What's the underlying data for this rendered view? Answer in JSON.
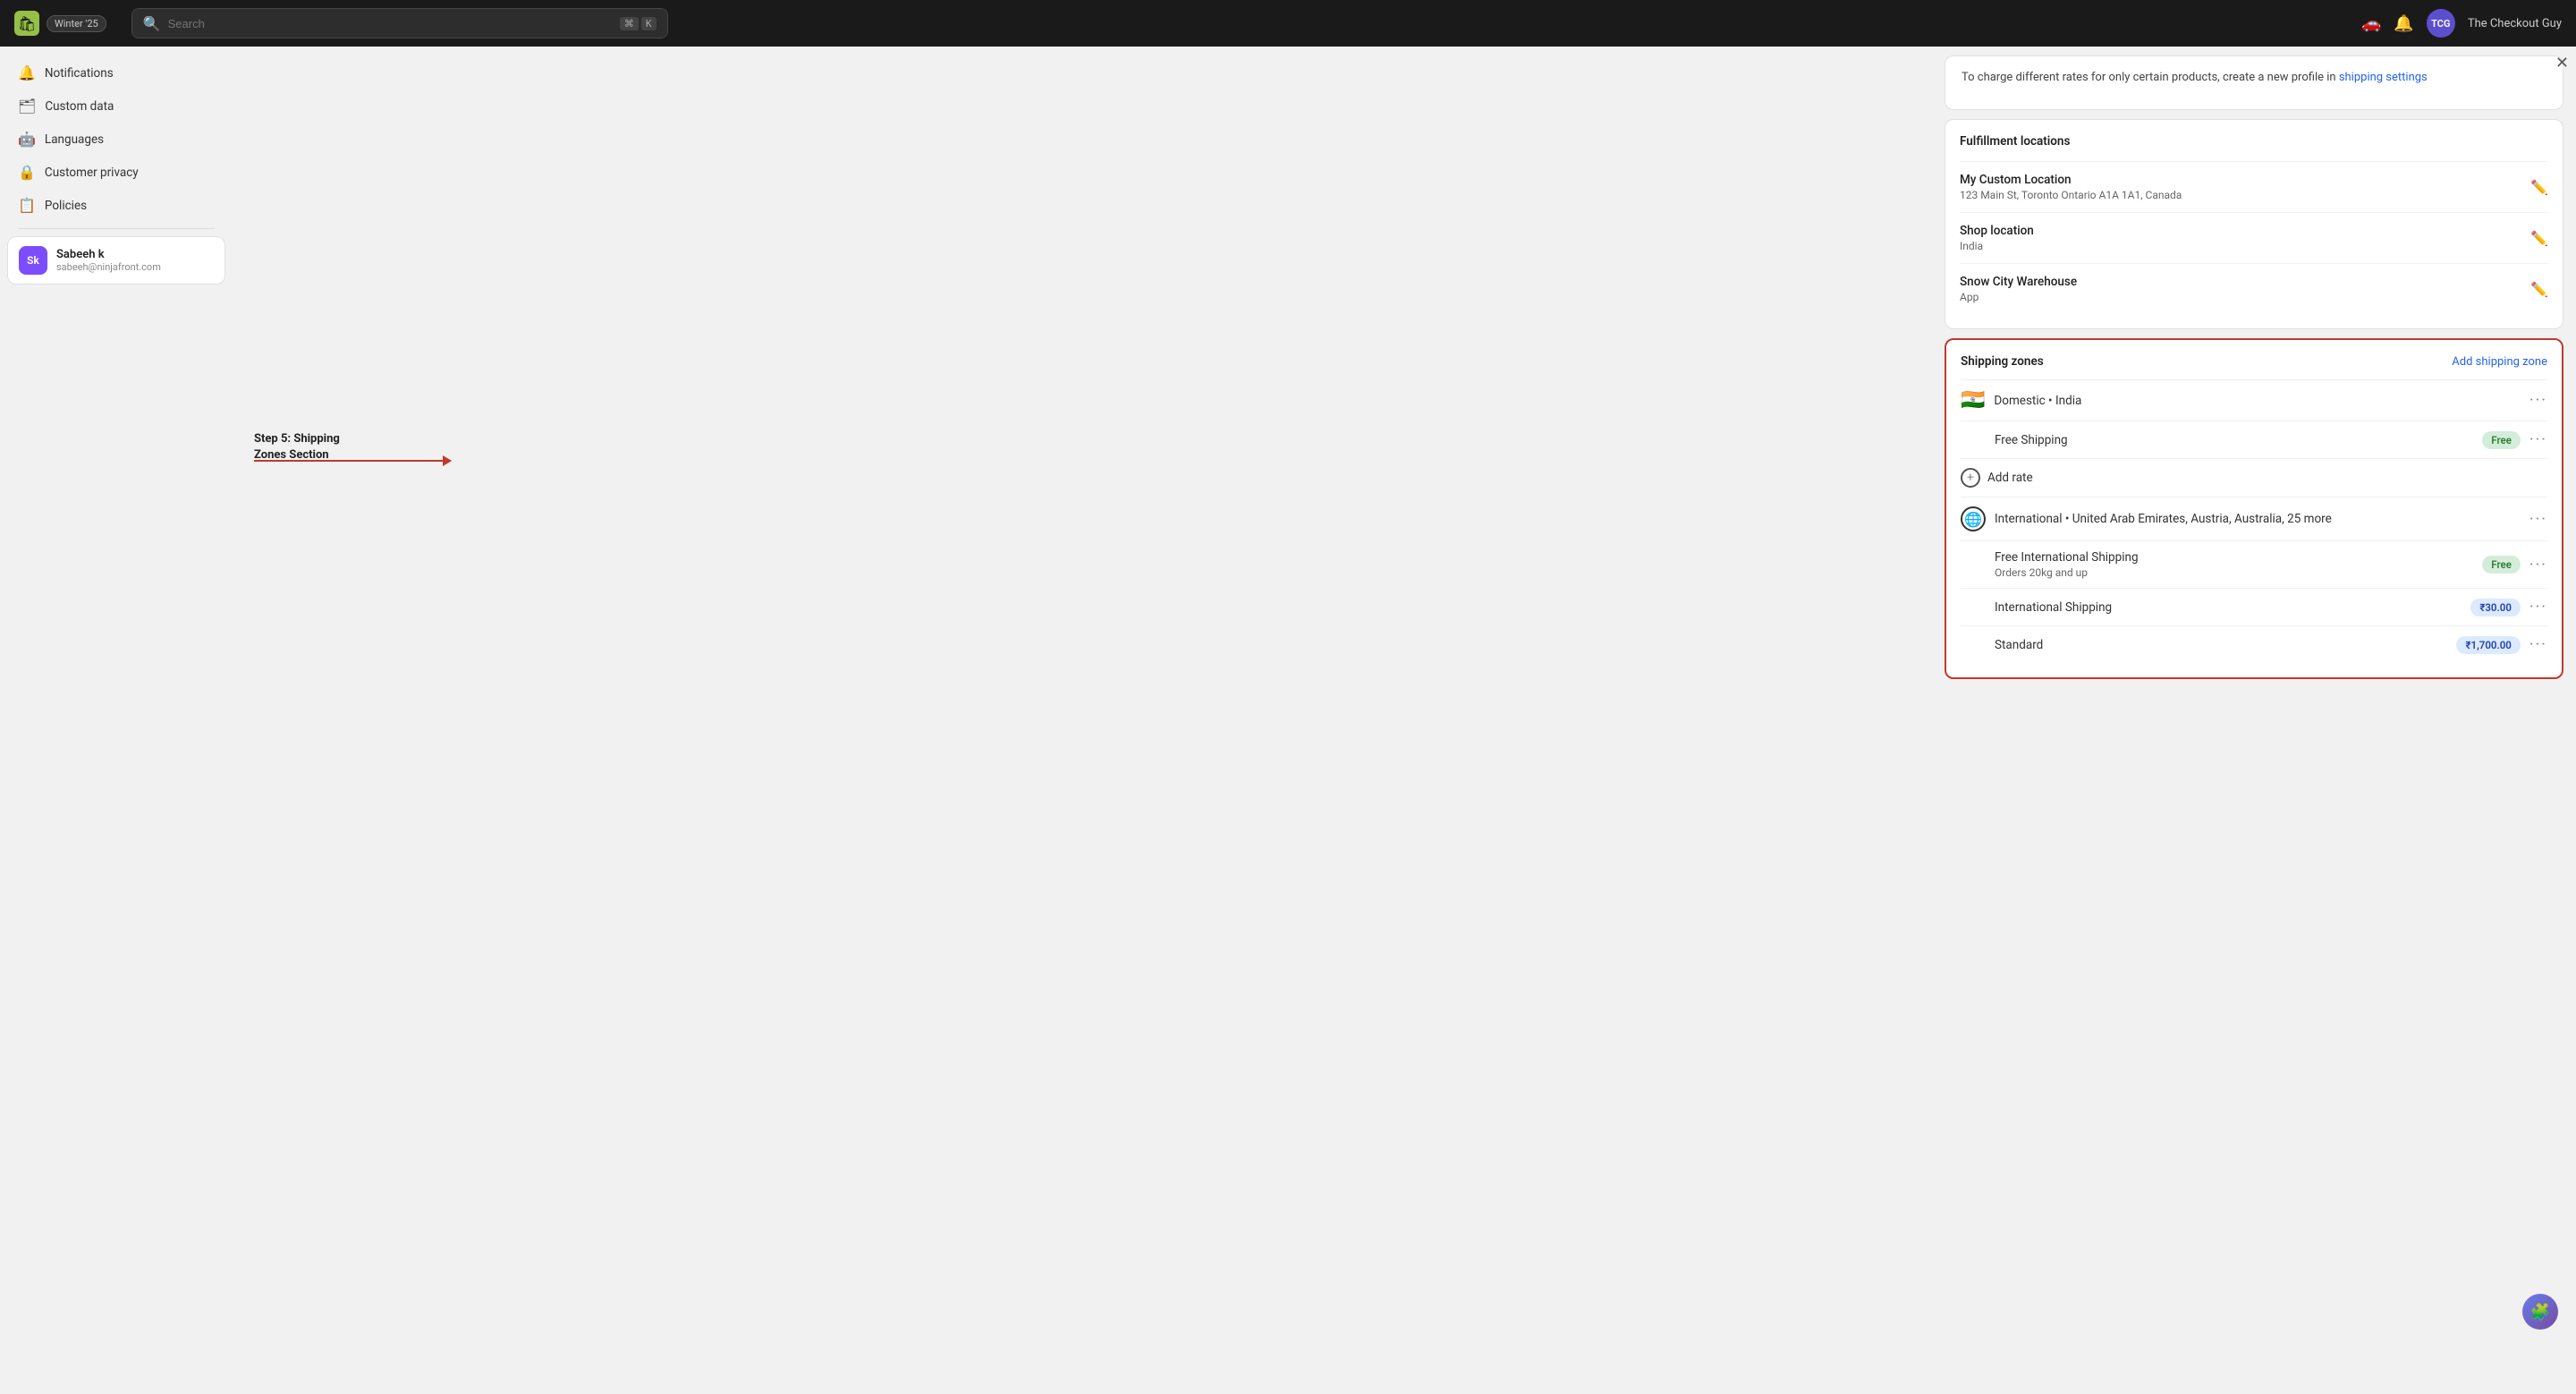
{
  "topnav": {
    "logo_emoji": "🛍",
    "app_name": "shopify",
    "winter_badge": "Winter '25",
    "search_placeholder": "Search",
    "shortcut_key1": "⌘",
    "shortcut_key2": "K",
    "user_initials": "TCG",
    "user_name": "The Checkout Guy"
  },
  "sidebar": {
    "items": [
      {
        "id": "notifications",
        "icon": "🔔",
        "label": "Notifications"
      },
      {
        "id": "custom-data",
        "icon": "🗂",
        "label": "Custom data"
      },
      {
        "id": "languages",
        "icon": "🤖",
        "label": "Languages"
      },
      {
        "id": "customer-privacy",
        "icon": "🔒",
        "label": "Customer privacy"
      },
      {
        "id": "policies",
        "icon": "📋",
        "label": "Policies"
      }
    ],
    "user": {
      "initials": "Sk",
      "name": "Sabeeh k",
      "email": "sabeeh@ninjafront.com"
    }
  },
  "annotation": {
    "step_label": "Step 5: Shipping\nZones Section"
  },
  "info_text": "To charge different rates for only certain products, create a new profile in",
  "shipping_settings_link": "shipping settings",
  "fulfillment": {
    "title": "Fulfillment locations",
    "locations": [
      {
        "name": "My Custom Location",
        "address": "123 Main St, Toronto Ontario A1A 1A1, Canada"
      },
      {
        "name": "Shop location",
        "address": "India"
      },
      {
        "name": "Snow City Warehouse",
        "address": "App"
      }
    ]
  },
  "shipping_zones": {
    "title": "Shipping zones",
    "add_label": "Add shipping zone",
    "zones": [
      {
        "id": "domestic",
        "flag": "🇮🇳",
        "name": "Domestic • India",
        "rates": [
          {
            "name": "Free Shipping",
            "sub": "",
            "badge_type": "free",
            "badge_text": "Free"
          }
        ]
      },
      {
        "id": "international",
        "flag": "🌐",
        "name": "International • United Arab Emirates, Austria, Australia, 25 more",
        "rates": [
          {
            "name": "Free International Shipping",
            "sub": "Orders 20kg and up",
            "badge_type": "free",
            "badge_text": "Free"
          },
          {
            "name": "International Shipping",
            "sub": "",
            "badge_type": "price",
            "badge_text": "₹30.00"
          },
          {
            "name": "Standard",
            "sub": "",
            "badge_type": "price",
            "badge_text": "₹1,700.00"
          }
        ]
      }
    ],
    "add_rate_label": "Add rate"
  }
}
